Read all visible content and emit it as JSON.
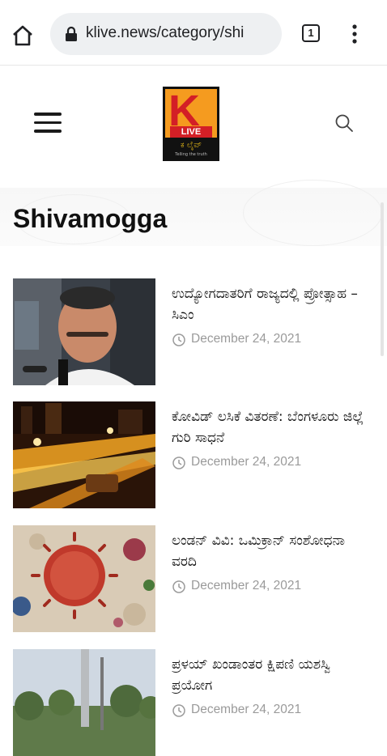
{
  "browser": {
    "url": "klive.news/category/shi",
    "tab_count": "1",
    "icons": {
      "home": "home-icon",
      "lock": "lock-icon",
      "menu": "more-vert-icon"
    }
  },
  "site": {
    "logo_letter": "K",
    "logo_live": "LIVE",
    "logo_kannada": "ಕ ಲೈವ್",
    "logo_tagline": "Telling the truth",
    "brand_colors": {
      "orange": "#f59b1f",
      "red": "#d31f26",
      "black": "#111111"
    }
  },
  "category": {
    "title": "Shivamogga"
  },
  "articles": [
    {
      "headline": "ಉದ್ಯೋಗದಾತರಿಗೆ ರಾಜ್ಯದಲ್ಲಿ ಪ್ರೋತ್ಸಾಹ – ಸಿಎಂ",
      "date": "December 24, 2021"
    },
    {
      "headline": "ಕೋವಿಡ್ ಲಸಿಕೆ ವಿತರಣೆ: ಬೆಂಗಳೂರು ಜಿಲ್ಲೆ ಗುರಿ ಸಾಧನೆ",
      "date": "December 24, 2021"
    },
    {
      "headline": "ಲಂಡನ್ ವಿವಿ: ಒಮಿಕ್ರಾನ್ ಸಂಶೋಧನಾ ವರದಿ",
      "date": "December 24, 2021"
    },
    {
      "headline": "ಪ್ರಳಯ್ ಖಂಡಾಂತರ ಕ್ಷಿಪಣಿ ಯಶಸ್ವಿ ಪ್ರಯೋಗ",
      "date": "December 24, 2021"
    }
  ]
}
